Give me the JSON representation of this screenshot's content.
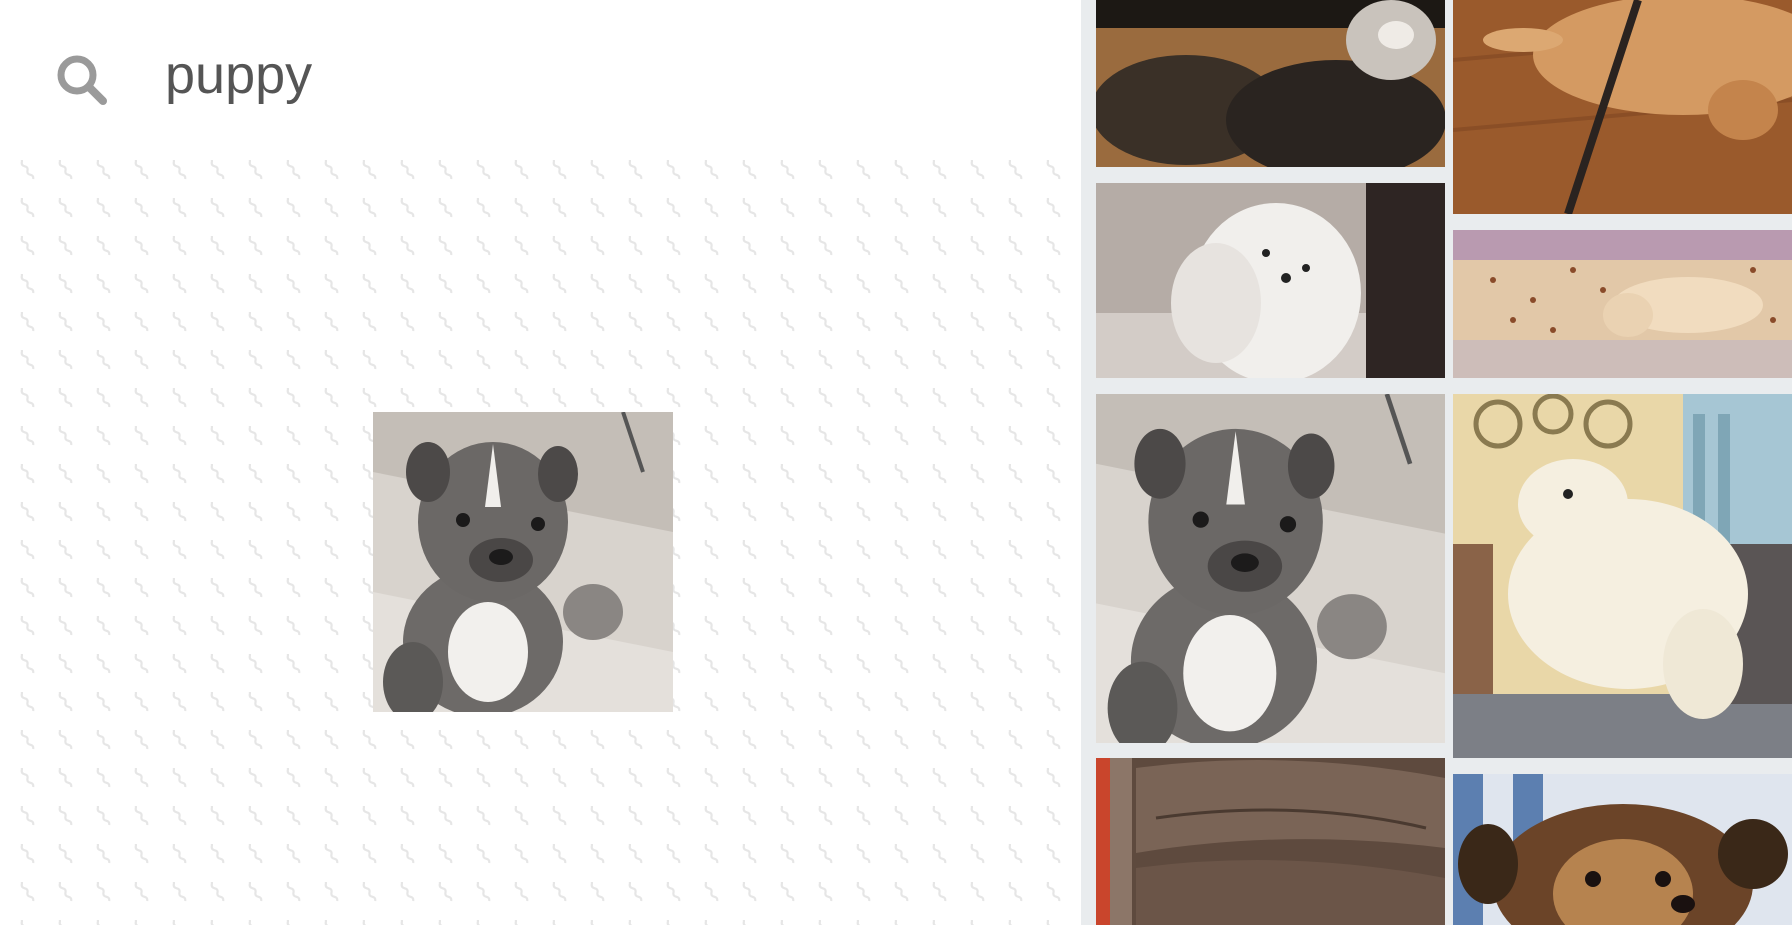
{
  "search": {
    "query": "puppy",
    "icon": "search-icon"
  },
  "preview": {
    "selected": "bulldog-puppy-waving"
  },
  "results": {
    "column_1": [
      "puppy-in-dark-room",
      "white-fluffy-puppy",
      "bulldog-puppy-waving",
      "leather-couch"
    ],
    "column_2": [
      "golden-puppy-on-leash",
      "lab-puppy-with-kibble",
      "white-puppy-climbing",
      "yorkie-puppy"
    ]
  },
  "colors": {
    "search_text": "#555555",
    "search_icon": "#9a9a9a",
    "pane_background": "#e9ecee",
    "pattern": "#e6e6e6"
  }
}
